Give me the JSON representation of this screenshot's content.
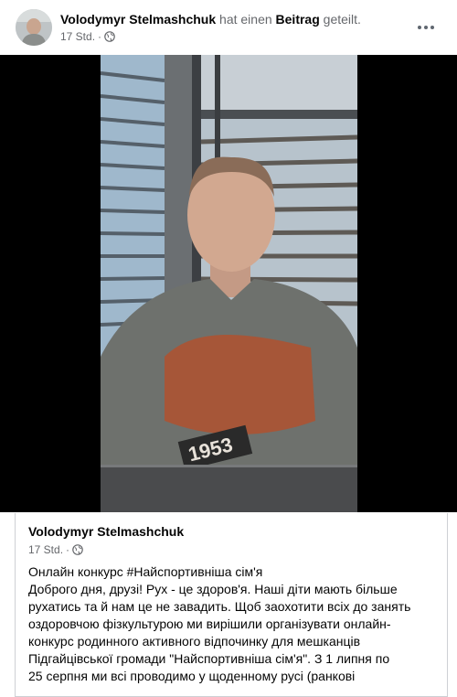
{
  "post": {
    "author": "Volodymyr Stelmashchuk",
    "action": "hat einen",
    "object": "Beitrag",
    "action_tail": "geteilt.",
    "time": "17 Std.",
    "separator": "·",
    "audience_icon": "globe-icon",
    "more_icon": "more-options-icon"
  },
  "video": {
    "sound_icon": "speaker-muted-icon",
    "shirt_text": "1953"
  },
  "shared": {
    "author": "Volodymyr Stelmashchuk",
    "time": "17 Std.",
    "separator": "·",
    "audience_icon": "globe-icon",
    "lines": [
      "Онлайн конкурс #Найспортивніша сім'я",
      "Доброго дня, друзі! Рух - це здоров'я. Наші діти мають більше",
      "рухатись та й нам це не завадить. Щоб заохотити всіх до занять",
      "оздоровчою фізкультурою ми вирішили організувати онлайн-",
      "конкурс родинного активного відпочинку для мешканців",
      "Підгайцівської громади \"Найспортивніша сім'я\". З 1 липня по",
      "25 серпня ми всі проводимо у щоденному русі (ранкові"
    ]
  },
  "colors": {
    "text_primary": "#050505",
    "text_secondary": "#65676b",
    "border": "#ced0d4",
    "video_bg": "#000000"
  }
}
